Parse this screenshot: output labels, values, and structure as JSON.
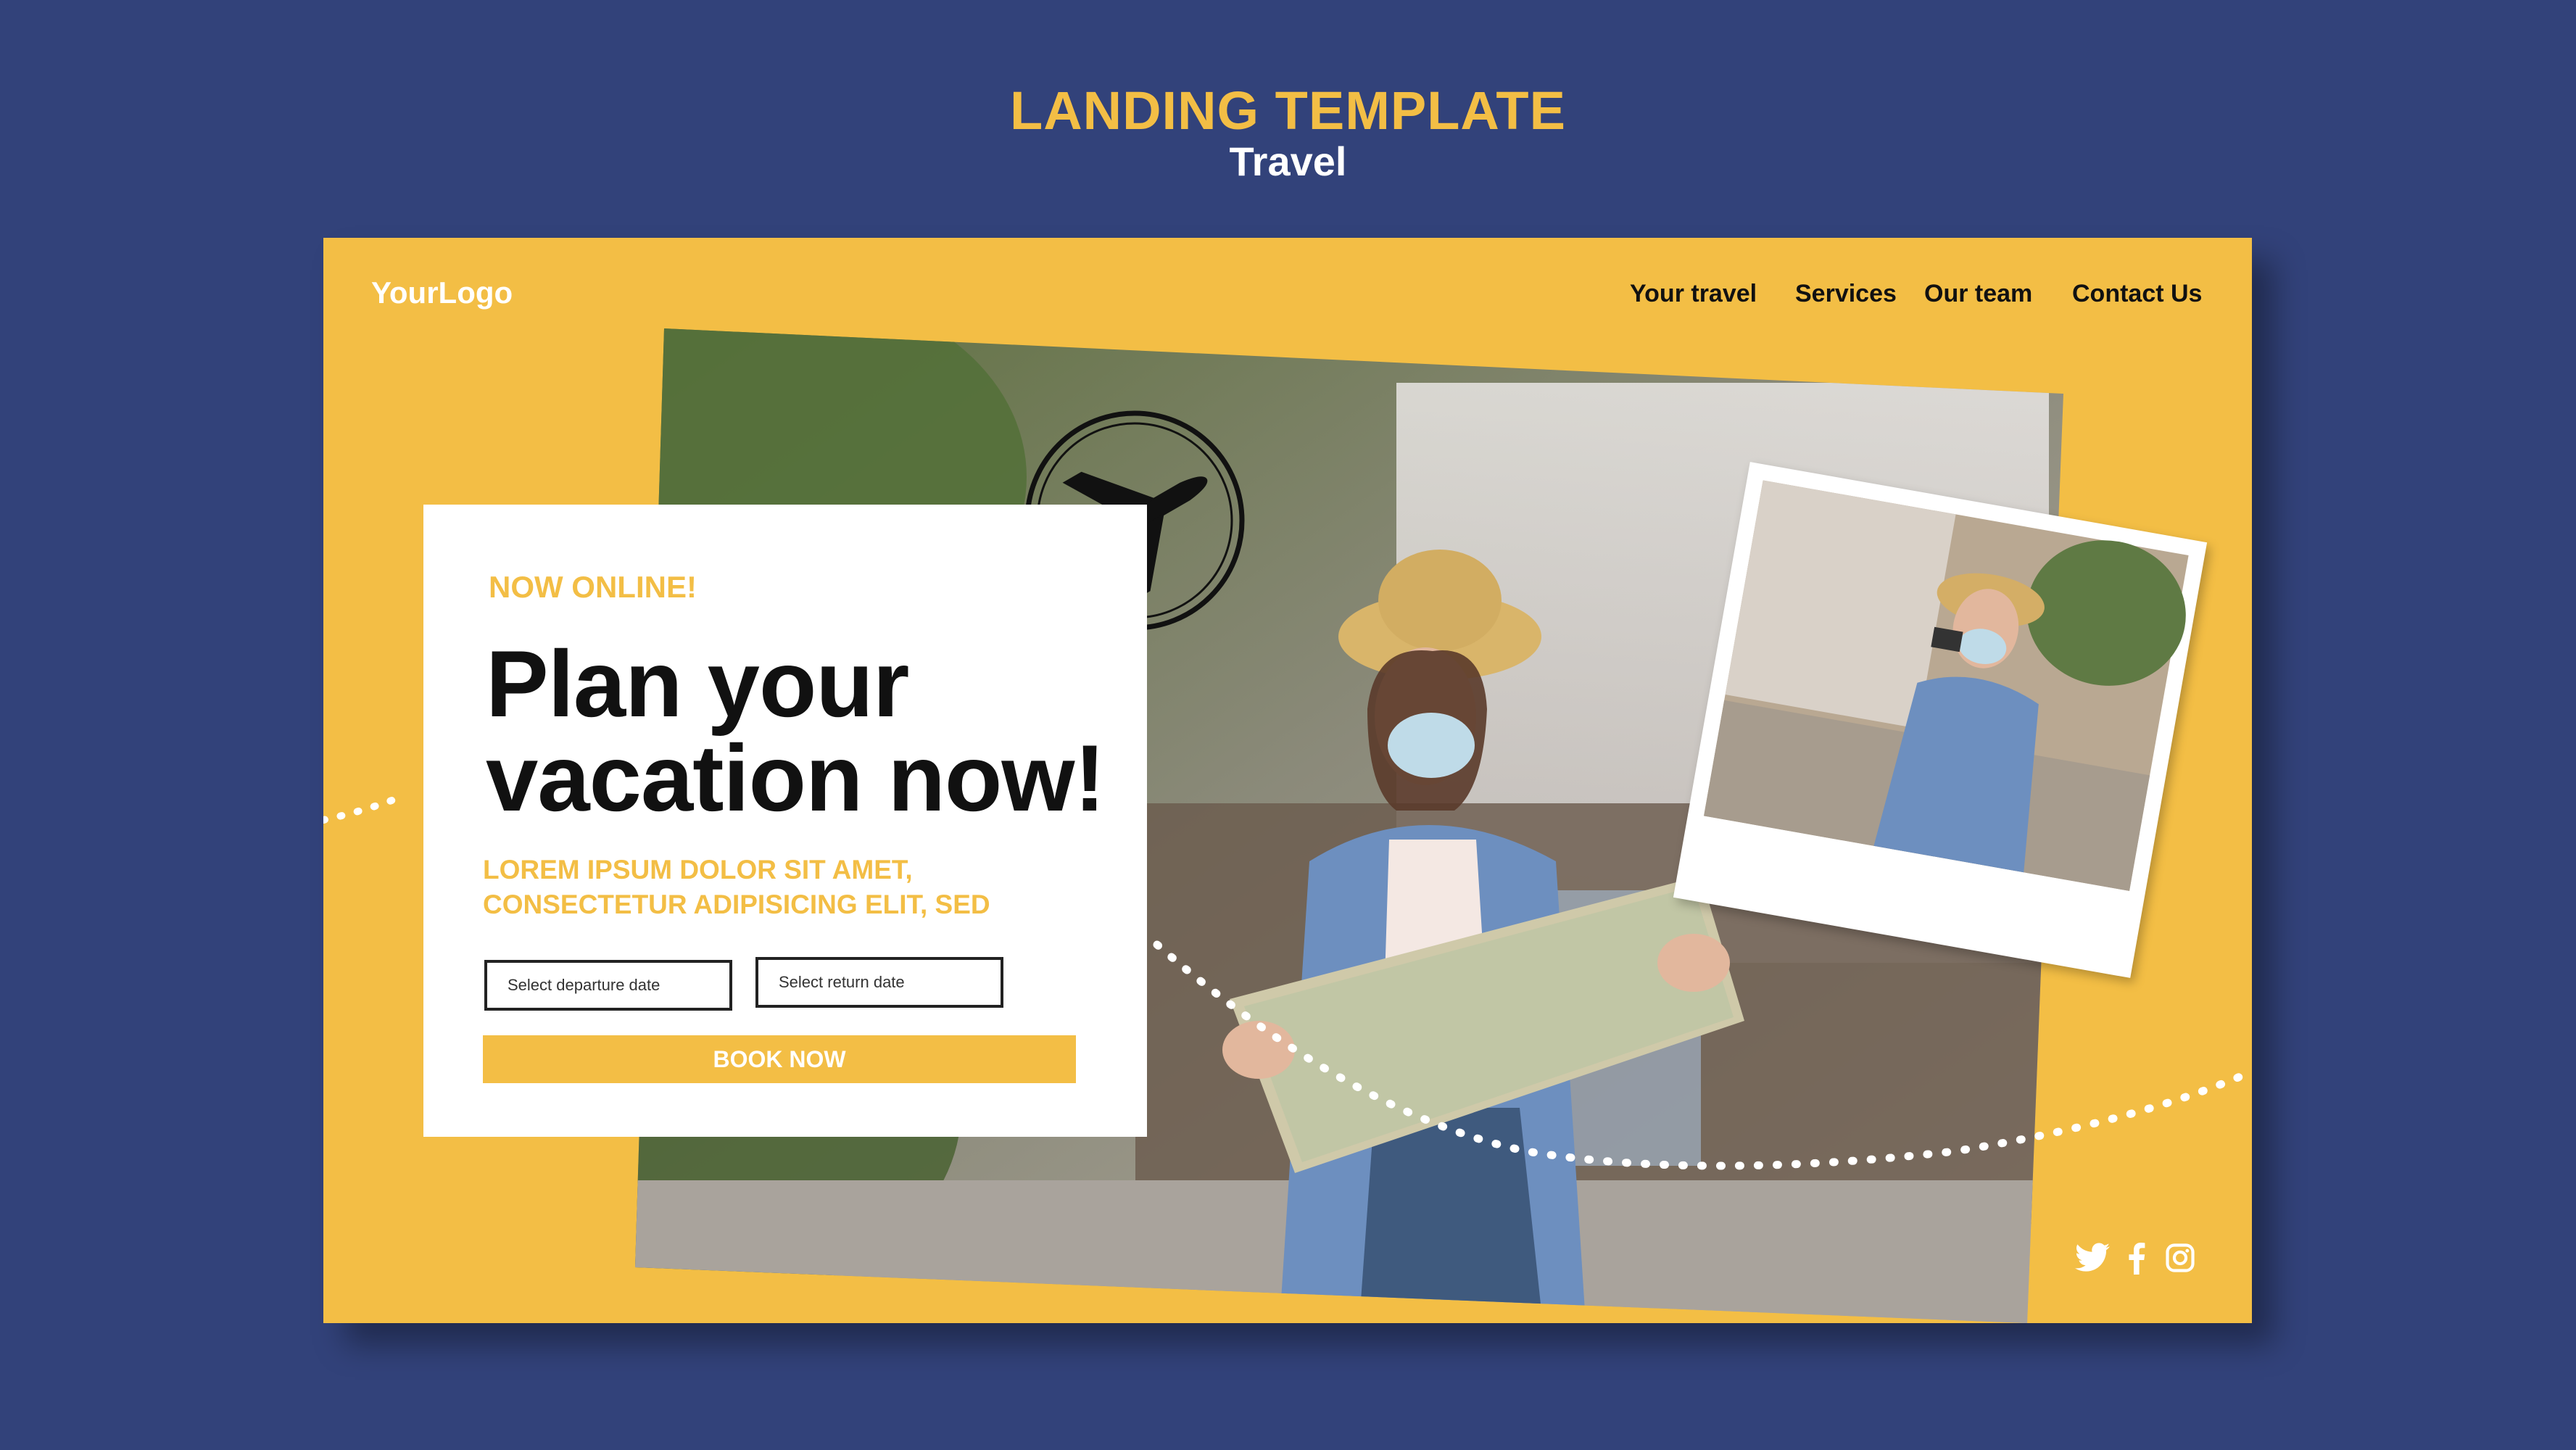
{
  "header": {
    "title": "LANDING TEMPLATE",
    "subtitle": "Travel"
  },
  "site": {
    "logo": "YourLogo",
    "nav": [
      {
        "label": "Your travel"
      },
      {
        "label": "Services"
      },
      {
        "label": "Our team"
      },
      {
        "label": "Contact Us"
      }
    ]
  },
  "hero": {
    "eyebrow": "NOW ONLINE!",
    "headline_line1": "Plan your",
    "headline_line2": "vacation now!",
    "lorem_line1": "LOREM IPSUM DOLOR SIT AMET,",
    "lorem_line2": "CONSECTETUR ADIPISICING ELIT, SED",
    "departure_placeholder": "Select departure date",
    "return_placeholder": "Select return date",
    "book_label": "BOOK NOW"
  },
  "social": {
    "icons": [
      "twitter-icon",
      "facebook-icon",
      "instagram-icon"
    ]
  },
  "colors": {
    "background": "#32427a",
    "accent": "#f3be45",
    "card_white": "#ffffff"
  }
}
